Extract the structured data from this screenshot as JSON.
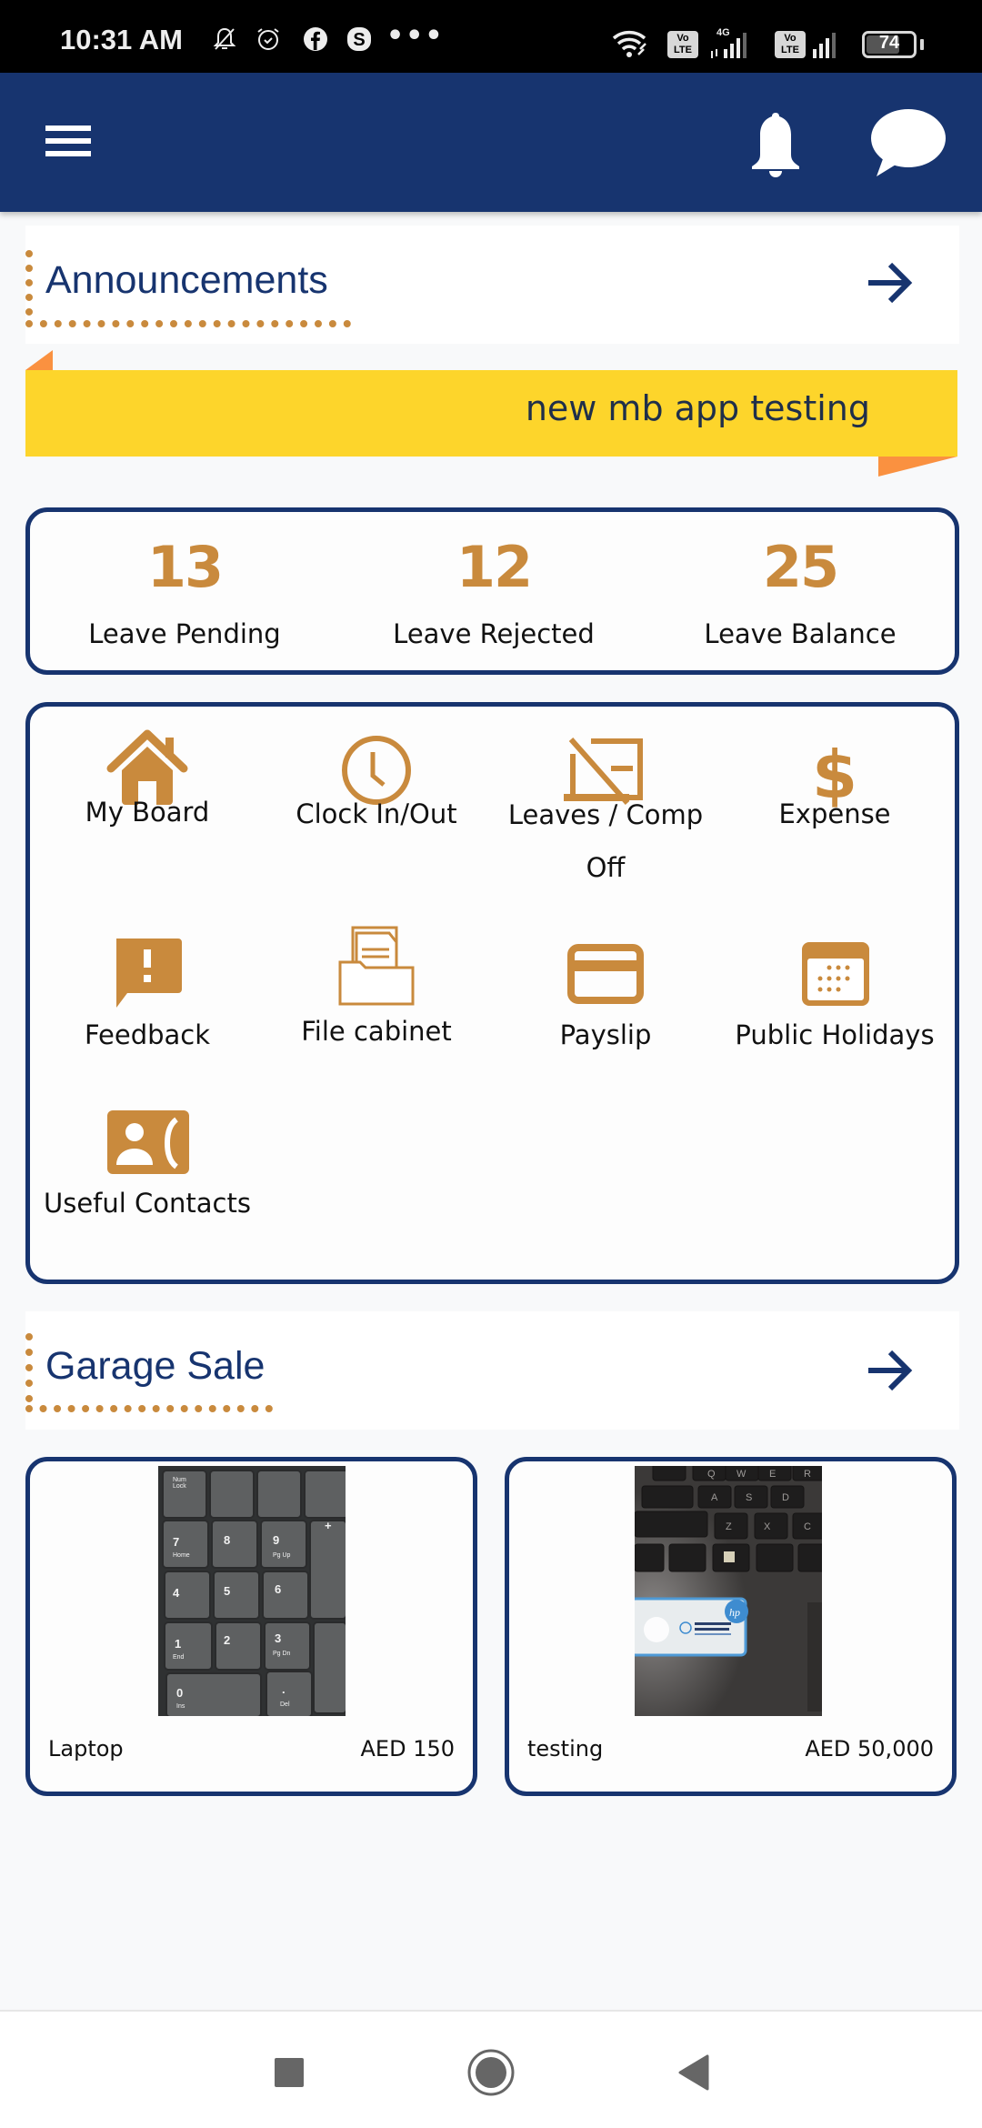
{
  "status_bar": {
    "time": "10:31 AM",
    "left_icons": [
      "bell-off-icon",
      "alarm-icon",
      "facebook-icon",
      "skype-icon"
    ],
    "more_indicator": "•••",
    "right_icons": [
      "wifi-icon",
      "volte-icon",
      "signal-4g-icon",
      "volte-icon",
      "signal-icon",
      "battery-icon"
    ],
    "network_label": "4G",
    "volte_label_top": "Vo",
    "volte_label_bottom": "LTE",
    "battery_level": "74",
    "battery_fraction": 0.74
  },
  "app_bar": {
    "menu_icon": "hamburger-menu-icon",
    "notifications_icon": "bell-icon",
    "messages_icon": "chat-bubble-icon",
    "background_color": "#17346F"
  },
  "announcements": {
    "title": "Announcements",
    "arrow_icon": "arrow-right-icon",
    "banner_text": "new mb app testing",
    "banner_color": "#FDD52B",
    "fold_color": "#FA9140"
  },
  "leave_stats": [
    {
      "value": "13",
      "label": "Leave Pending"
    },
    {
      "value": "12",
      "label": "Leave Rejected"
    },
    {
      "value": "25",
      "label": "Leave Balance"
    }
  ],
  "menu": {
    "accent_color": "#C98A3D",
    "items": [
      {
        "label": "My Board",
        "icon": "home-icon"
      },
      {
        "label": "Clock In/Out",
        "icon": "clock-icon"
      },
      {
        "label": "Leaves / Comp Off",
        "icon": "desktop-access-disabled-icon"
      },
      {
        "label": "Expense",
        "icon": "dollar-icon"
      },
      {
        "label": "Feedback",
        "icon": "feedback-icon"
      },
      {
        "label": "File cabinet",
        "icon": "file-cabinet-icon"
      },
      {
        "label": "Payslip",
        "icon": "credit-card-icon"
      },
      {
        "label": "Public Holidays",
        "icon": "calendar-icon"
      },
      {
        "label": "Useful Contacts",
        "icon": "contact-phone-icon"
      }
    ]
  },
  "garage_sale": {
    "title": "Garage Sale",
    "arrow_icon": "arrow-right-icon",
    "items": [
      {
        "name": "Laptop",
        "price": "AED 150",
        "image": "numeric-keypad-photo"
      },
      {
        "name": "testing",
        "price": "AED 50,000",
        "image": "laptop-keyboard-photo"
      }
    ]
  },
  "nav_bar": {
    "recents_icon": "recents-square-icon",
    "home_icon": "home-circle-icon",
    "back_icon": "back-triangle-icon"
  }
}
